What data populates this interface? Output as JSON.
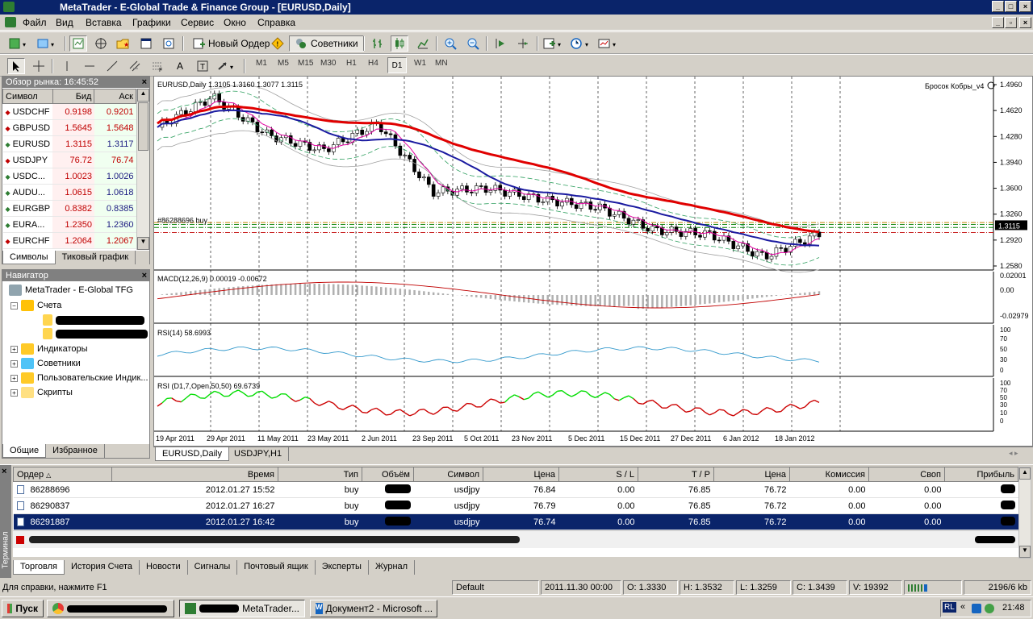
{
  "window": {
    "title": "MetaTrader - E-Global Trade & Finance Group - [EURUSD,Daily]"
  },
  "menu": [
    "Файл",
    "Вид",
    "Вставка",
    "Графики",
    "Сервис",
    "Окно",
    "Справка"
  ],
  "toolbar": {
    "new_order": "Новый Ордер",
    "experts": "Советники",
    "timeframes": [
      "M1",
      "M5",
      "M15",
      "M30",
      "H1",
      "H4",
      "D1",
      "W1",
      "MN"
    ],
    "active_timeframe": "D1",
    "text_tool": "A"
  },
  "market_watch": {
    "title": "Обзор рынка: 16:45:52",
    "columns": [
      "Символ",
      "Бид",
      "Аск"
    ],
    "rows": [
      {
        "symbol": "USDCHF",
        "bid": "0.9198",
        "ask": "0.9201",
        "dir": "down"
      },
      {
        "symbol": "GBPUSD",
        "bid": "1.5645",
        "ask": "1.5648",
        "dir": "down"
      },
      {
        "symbol": "EURUSD",
        "bid": "1.3115",
        "ask": "1.3117",
        "dir": "up"
      },
      {
        "symbol": "USDJPY",
        "bid": "76.72",
        "ask": "76.74",
        "dir": "down"
      },
      {
        "symbol": "USDC...",
        "bid": "1.0023",
        "ask": "1.0026",
        "dir": "up"
      },
      {
        "symbol": "AUDU...",
        "bid": "1.0615",
        "ask": "1.0618",
        "dir": "up"
      },
      {
        "symbol": "EURGBP",
        "bid": "0.8382",
        "ask": "0.8385",
        "dir": "up"
      },
      {
        "symbol": "EURA...",
        "bid": "1.2350",
        "ask": "1.2360",
        "dir": "up"
      },
      {
        "symbol": "EURCHF",
        "bid": "1.2064",
        "ask": "1.2067",
        "dir": "down"
      }
    ],
    "tabs": [
      "Символы",
      "Тиковый график"
    ]
  },
  "navigator": {
    "title": "Навигатор",
    "root": "MetaTrader - E-Global TFG",
    "accounts": "Счета",
    "items": [
      "Индикаторы",
      "Советники",
      "Пользовательские Индик...",
      "Скрипты"
    ],
    "tabs": [
      "Общие",
      "Избранное"
    ]
  },
  "chart": {
    "header": "EURUSD,Daily  1.3105 1.3160 1.3077 1.3115",
    "expert_label": "Бросок Кобры_v4",
    "order_label": "#86288696 buy",
    "price_levels": [
      "1.4960",
      "1.4620",
      "1.4280",
      "1.3940",
      "1.3600",
      "1.3260",
      "1.2920",
      "1.2580"
    ],
    "current_price": "1.3115",
    "macd_label": "MACD(12,26,9) 0.00019 -0.00672",
    "macd_levels": [
      "0.02001",
      "0.00",
      "-0.02979"
    ],
    "rsi_label": "RSI(14) 58.6993",
    "rsi_levels": [
      "100",
      "70",
      "50",
      "30",
      "0"
    ],
    "rsi2_label": "RSI (D1,7,Open,50,50) 69.6739",
    "rsi2_levels": [
      "100",
      "70",
      "50",
      "30",
      "10",
      "0"
    ],
    "dates": [
      "19 Apr 2011",
      "29 Apr 2011",
      "11 May 2011",
      "23 May 2011",
      "2 Jun 2011",
      "23 Sep 2011",
      "5 Oct 2011",
      "23 Nov 2011",
      "5 Dec 2011",
      "15 Dec 2011",
      "27 Dec 2011",
      "6 Jan 2012",
      "18 Jan 2012"
    ],
    "tabs": [
      "EURUSD,Daily",
      "USDJPY,H1"
    ],
    "colors": {
      "ma_slow": "#e00000",
      "ma_mid": "#1a1aa0",
      "ma_fast": "#e000a0",
      "bands": "#a0a0a0",
      "envelope": "#30a060"
    }
  },
  "chart_data": {
    "type": "line",
    "title": "EURUSD,Daily",
    "x": [
      "19 Apr 2011",
      "29 Apr 2011",
      "11 May 2011",
      "23 May 2011",
      "2 Jun 2011",
      "23 Sep 2011",
      "5 Oct 2011",
      "23 Nov 2011",
      "5 Dec 2011",
      "15 Dec 2011",
      "27 Dec 2011",
      "6 Jan 2012",
      "18 Jan 2012"
    ],
    "series": [
      {
        "values": [
          1.44,
          1.48,
          1.43,
          1.41,
          1.445,
          1.355,
          1.36,
          1.345,
          1.335,
          1.305,
          1.3,
          1.27,
          1.3
        ]
      }
    ],
    "ylim": [
      1.258,
      1.496
    ],
    "current": 1.3115
  },
  "terminal": {
    "columns": [
      "Ордер",
      "Время",
      "Тип",
      "Объём",
      "Символ",
      "Цена",
      "S / L",
      "T / P",
      "Цена",
      "Комиссия",
      "Своп",
      "Прибыль"
    ],
    "rows": [
      {
        "order": "86288696",
        "time": "2012.01.27 15:52",
        "type": "buy",
        "symbol": "usdjpy",
        "price": "76.84",
        "sl": "0.00",
        "tp": "76.85",
        "cur": "76.72",
        "comm": "0.00",
        "swap": "0.00"
      },
      {
        "order": "86290837",
        "time": "2012.01.27 16:27",
        "type": "buy",
        "symbol": "usdjpy",
        "price": "76.79",
        "sl": "0.00",
        "tp": "76.85",
        "cur": "76.72",
        "comm": "0.00",
        "swap": "0.00"
      },
      {
        "order": "86291887",
        "time": "2012.01.27 16:42",
        "type": "buy",
        "symbol": "usdjpy",
        "price": "76.74",
        "sl": "0.00",
        "tp": "76.85",
        "cur": "76.72",
        "comm": "0.00",
        "swap": "0.00"
      }
    ],
    "side_label": "Терминал",
    "tabs": [
      "Торговля",
      "История Счета",
      "Новости",
      "Сигналы",
      "Почтовый ящик",
      "Эксперты",
      "Журнал"
    ]
  },
  "status": {
    "help": "Для справки, нажмите F1",
    "profile": "Default",
    "datetime": "2011.11.30 00:00",
    "open": "O: 1.3330",
    "high": "H: 1.3532",
    "low": "L: 1.3259",
    "close": "C: 1.3439",
    "volume": "V: 19392",
    "traffic": "2196/6 kb"
  },
  "taskbar": {
    "start": "Пуск",
    "items": [
      "MetaTrader...",
      "Документ2 - Microsoft ..."
    ],
    "lang": "RL",
    "clock": "21:48"
  }
}
